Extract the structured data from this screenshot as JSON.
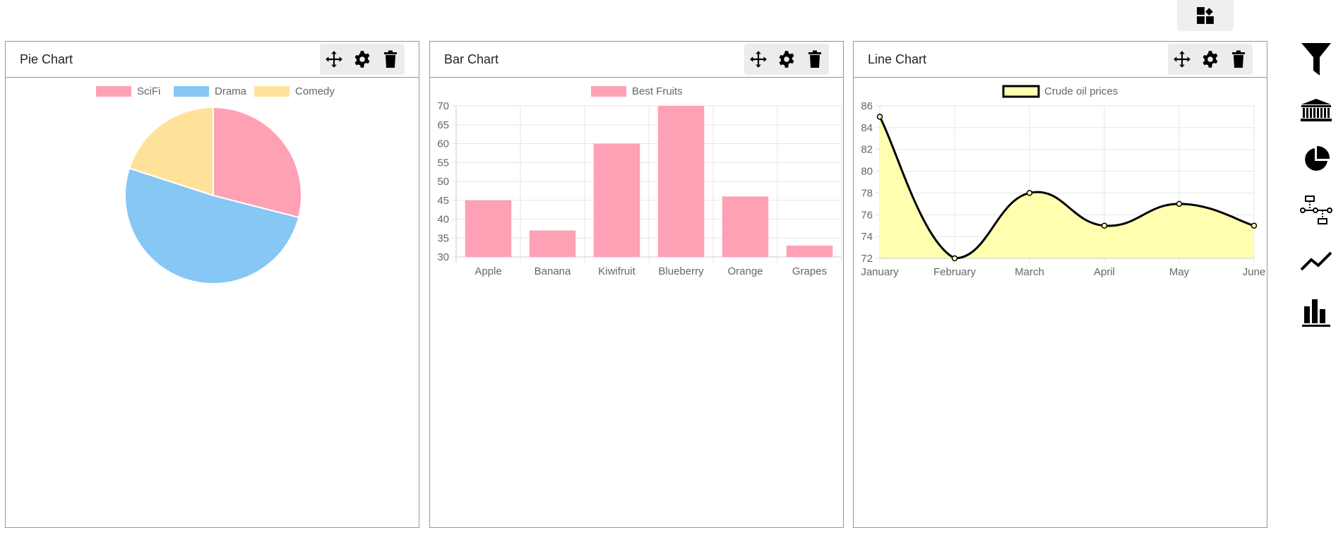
{
  "toolbar": {
    "layout_icon": "dashboard-icon"
  },
  "header_buttons": {
    "move_icon": "move-arrows-icon",
    "settings_icon": "gear-icon",
    "delete_icon": "trash-icon"
  },
  "sidebar": {
    "items": [
      {
        "icon": "funnel-chart-icon"
      },
      {
        "icon": "bank-chart-icon"
      },
      {
        "icon": "pie-chart-icon"
      },
      {
        "icon": "flowchart-icon"
      },
      {
        "icon": "line-chart-icon"
      },
      {
        "icon": "bar-chart-icon"
      }
    ]
  },
  "panels": {
    "pie": {
      "title": "Pie Chart"
    },
    "bar": {
      "title": "Bar Chart"
    },
    "line": {
      "title": "Line Chart"
    }
  },
  "chart_data": [
    {
      "type": "pie",
      "title": "",
      "categories": [
        "SciFi",
        "Drama",
        "Comedy"
      ],
      "values": [
        29,
        51,
        20
      ],
      "colors": [
        "#ffa1b5",
        "#86c7f3",
        "#ffe29a"
      ],
      "legend": "top"
    },
    {
      "type": "bar",
      "title": "",
      "categories": [
        "Apple",
        "Banana",
        "Kiwifruit",
        "Blueberry",
        "Orange",
        "Grapes"
      ],
      "series": [
        {
          "name": "Best Fruits",
          "values": [
            45,
            37,
            60,
            70,
            46,
            33
          ]
        }
      ],
      "ylim": [
        30,
        70
      ],
      "yticks": [
        30,
        35,
        40,
        45,
        50,
        55,
        60,
        65,
        70
      ],
      "colors": [
        "#ffa1b5"
      ],
      "grid": true,
      "legend": "top"
    },
    {
      "type": "area",
      "title": "",
      "categories": [
        "January",
        "February",
        "March",
        "April",
        "May",
        "June"
      ],
      "series": [
        {
          "name": "Crude oil prices",
          "values": [
            85,
            72,
            78,
            75,
            77,
            75
          ]
        }
      ],
      "ylim": [
        72,
        86
      ],
      "yticks": [
        72,
        74,
        76,
        78,
        80,
        82,
        84,
        86
      ],
      "colors": [
        "#000000",
        "#ffffaf"
      ],
      "grid": true,
      "legend": "top"
    }
  ]
}
